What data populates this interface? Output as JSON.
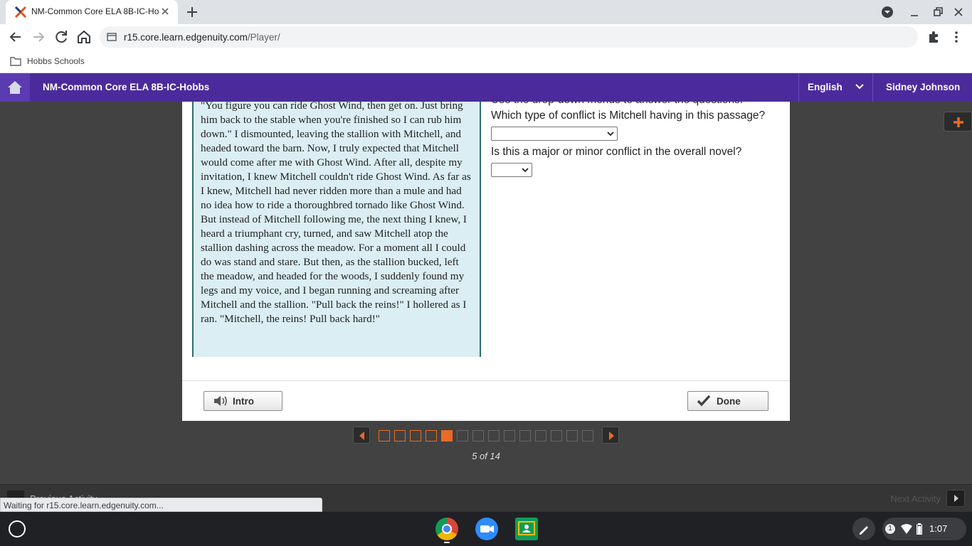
{
  "browser": {
    "tab_title": "NM-Common Core ELA 8B-IC-Ho",
    "url_host": "r15.core.learn.edgenuity.com",
    "url_path": "/Player/",
    "bookmark": "Hobbs Schools",
    "status_text": "Waiting for r15.core.learn.edgenuity.com..."
  },
  "app": {
    "course_title": "NM-Common Core ELA 8B-IC-Hobbs",
    "language": "English",
    "user_name": "Sidney Johnson",
    "brand_color": "#4b2b9c"
  },
  "passage": {
    "text": "\"You figure you can ride Ghost Wind, then get on. Just bring him back to the stable when you're finished so I can rub him down.\" I dismounted, leaving the stallion with Mitchell, and headed toward the barn. Now, I truly expected that Mitchell would come after me with Ghost Wind. After all, despite my invitation, I knew Mitchell couldn't ride Ghost Wind. As far as I knew, Mitchell had never ridden more than a mule and had no idea how to ride a thoroughbred tornado like Ghost Wind. But instead of Mitchell following me, the next thing I knew, I heard a triumphant cry, turned, and saw Mitchell atop the stallion dashing across the meadow. For a moment all I could do was stand and stare. But then, as the stallion bucked, left the meadow, and headed for the woods, I suddenly found my legs and my voice, and I began running and screaming after Mitchell and the stallion. \"Pull back the reins!\" I hollered as I ran. \"Mitchell, the reins! Pull back hard!\""
  },
  "questions": {
    "instruction": "Use the drop-down menus to answer the questions.",
    "q1": "Which type of conflict is Mitchell having in this passage?",
    "q1_value": "",
    "q2": "Is this a major or minor conflict in the overall novel?",
    "q2_value": ""
  },
  "buttons": {
    "intro": "Intro",
    "done": "Done"
  },
  "pager": {
    "current": 5,
    "total": 14,
    "label": "5 of 14"
  },
  "activity": {
    "prev": "Previous Activity",
    "next": "Next Activity"
  },
  "shelf": {
    "time": "1:07",
    "notifications": "1"
  }
}
